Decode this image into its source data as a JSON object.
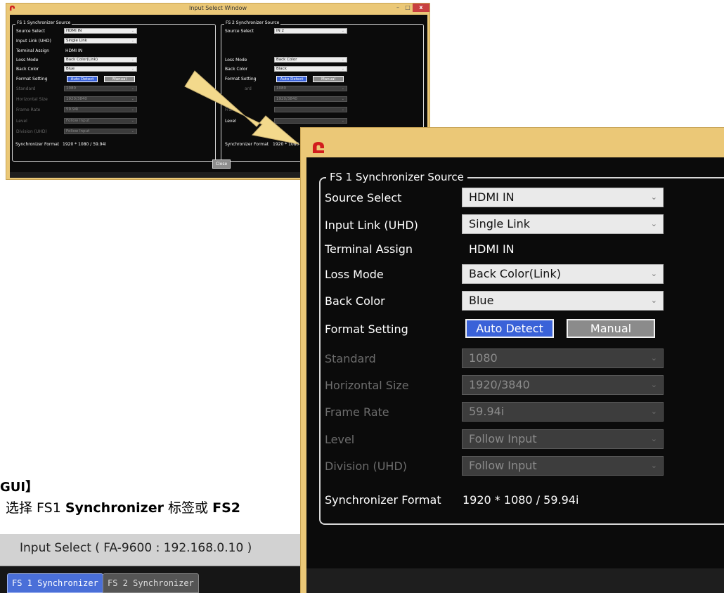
{
  "small_window": {
    "title": "Input Select Window",
    "window_buttons": {
      "minimize": "–",
      "maximize": "□",
      "close": "x"
    },
    "fs1": {
      "legend": "FS 1 Synchronizer Source",
      "rows": [
        {
          "label": "Source Select",
          "value": "HDMI IN",
          "kind": "select",
          "disabled": false
        },
        {
          "label": "Input Link (UHD)",
          "value": "Single Link",
          "kind": "select",
          "disabled": false
        },
        {
          "label": "Terminal Assign",
          "value": "HDMI IN",
          "kind": "text",
          "disabled": false
        },
        {
          "label": "Loss Mode",
          "value": "Back Color(Link)",
          "kind": "select",
          "disabled": false
        },
        {
          "label": "Back Color",
          "value": "Blue",
          "kind": "select",
          "disabled": false
        },
        {
          "label": "Format Setting",
          "kind": "buttons",
          "disabled": false
        },
        {
          "label": "Standard",
          "value": "1080",
          "kind": "select",
          "disabled": true
        },
        {
          "label": "Horizontal Size",
          "value": "1920/3840",
          "kind": "select",
          "disabled": true
        },
        {
          "label": "Frame Rate",
          "value": "59.94i",
          "kind": "select",
          "disabled": true
        },
        {
          "label": "Level",
          "value": "Follow Input",
          "kind": "select",
          "disabled": true
        },
        {
          "label": "Division (UHD)",
          "value": "Follow Input",
          "kind": "select",
          "disabled": true
        }
      ],
      "auto_detect": "Auto Detect",
      "manual": "Manual",
      "sync_label": "Synchronizer Format",
      "sync_value": "1920 * 1080 / 59.94i"
    },
    "fs2": {
      "legend": "FS 2 Synchronizer Source",
      "source_label": "Source Select",
      "source_value": "IN 2",
      "loss_label": "Loss Mode",
      "loss_value": "Back Color",
      "back_label": "Back Color",
      "back_value": "Black",
      "format_label": "Format Setting",
      "auto_detect": "Auto Detect",
      "manual": "Manual",
      "standard_partial": "ard",
      "standard_value": "1080",
      "hsize_value": "1920/3840",
      "frame_partial": "Frame",
      "level_label": "Level",
      "sync_label": "Synchronizer Format",
      "sync_value": "1920 * 1080"
    },
    "close_button": "Close"
  },
  "big_window": {
    "legend": "FS 1 Synchronizer Source",
    "source_select": {
      "label": "Source Select",
      "value": "HDMI IN"
    },
    "input_link": {
      "label": "Input Link (UHD)",
      "value": "Single Link"
    },
    "terminal_assign": {
      "label": "Terminal Assign",
      "value": "HDMI IN"
    },
    "loss_mode": {
      "label": "Loss Mode",
      "value": "Back Color(Link)"
    },
    "back_color": {
      "label": "Back Color",
      "value": "Blue"
    },
    "format_setting": {
      "label": "Format Setting",
      "auto_detect": "Auto Detect",
      "manual": "Manual"
    },
    "standard": {
      "label": "Standard",
      "value": "1080"
    },
    "horizontal_size": {
      "label": "Horizontal Size",
      "value": "1920/3840"
    },
    "frame_rate": {
      "label": "Frame Rate",
      "value": "59.94i"
    },
    "level": {
      "label": "Level",
      "value": "Follow Input"
    },
    "division": {
      "label": "Division (UHD)",
      "value": "Follow Input"
    },
    "sync_format": {
      "label": "Synchronizer Format",
      "value": "1920 * 1080 / 59.94i"
    }
  },
  "document": {
    "heading_fragment": "GUI】",
    "instruction_prefix": "选择 FS1 ",
    "instruction_bold1": "Synchronizer",
    "instruction_mid": " 标签或 ",
    "instruction_bold2": "FS2",
    "header_bar": "Input Select ( FA-9600 : 192.168.0.10 )",
    "tabs": [
      "FS 1 Synchronizer",
      "FS 2 Synchronizer"
    ]
  },
  "colors": {
    "window_frame": "#ebc877",
    "panel_bg": "#0b0b0b",
    "active_button": "#3a62d8",
    "inactive_button": "#8b8b8b",
    "arrow_fill": "#f3d98c"
  },
  "icons": [
    "logo-icon",
    "chevron-down-icon",
    "arrow-icon"
  ]
}
